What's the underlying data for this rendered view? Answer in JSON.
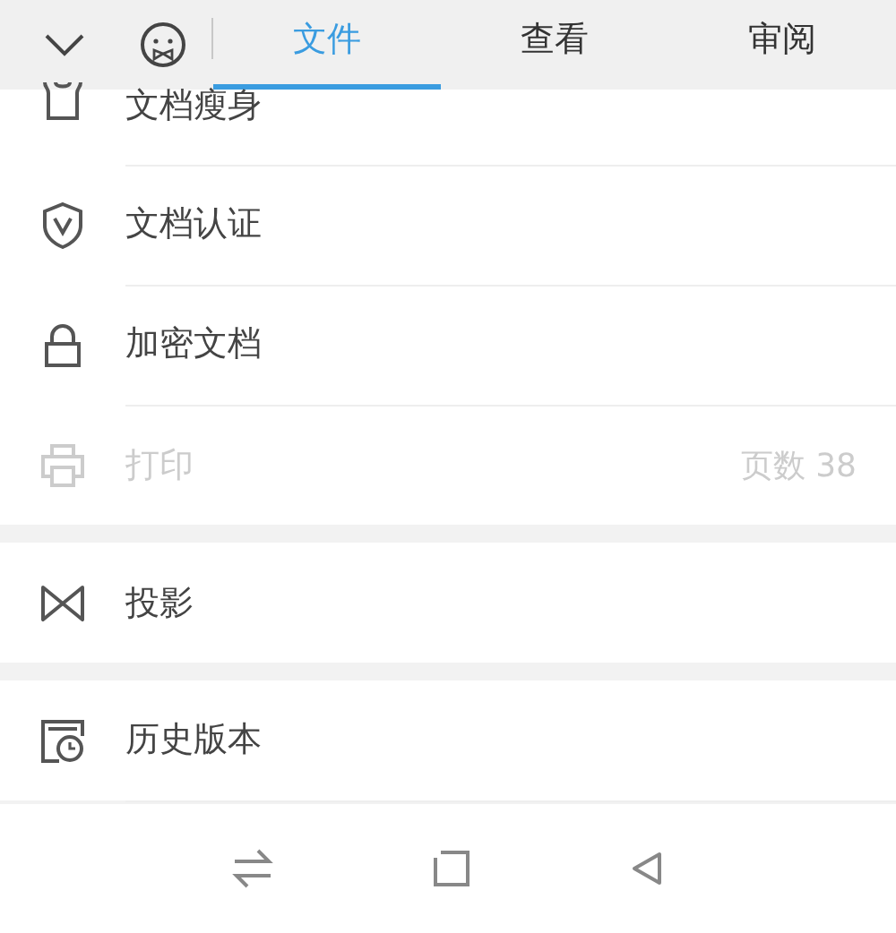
{
  "tabs": [
    {
      "label": "文件",
      "selected": true
    },
    {
      "label": "查看",
      "selected": false
    },
    {
      "label": "审阅",
      "selected": false
    }
  ],
  "sections": [
    {
      "items": [
        {
          "label": "文档瘦身",
          "disabled": false
        },
        {
          "label": "文档认证",
          "disabled": false
        },
        {
          "label": "加密文档",
          "disabled": false
        },
        {
          "label": "打印",
          "disabled": true,
          "detail": "页数 38"
        }
      ]
    },
    {
      "items": [
        {
          "label": "投影",
          "disabled": false
        }
      ]
    },
    {
      "items": [
        {
          "label": "历史版本",
          "disabled": false
        }
      ]
    }
  ]
}
